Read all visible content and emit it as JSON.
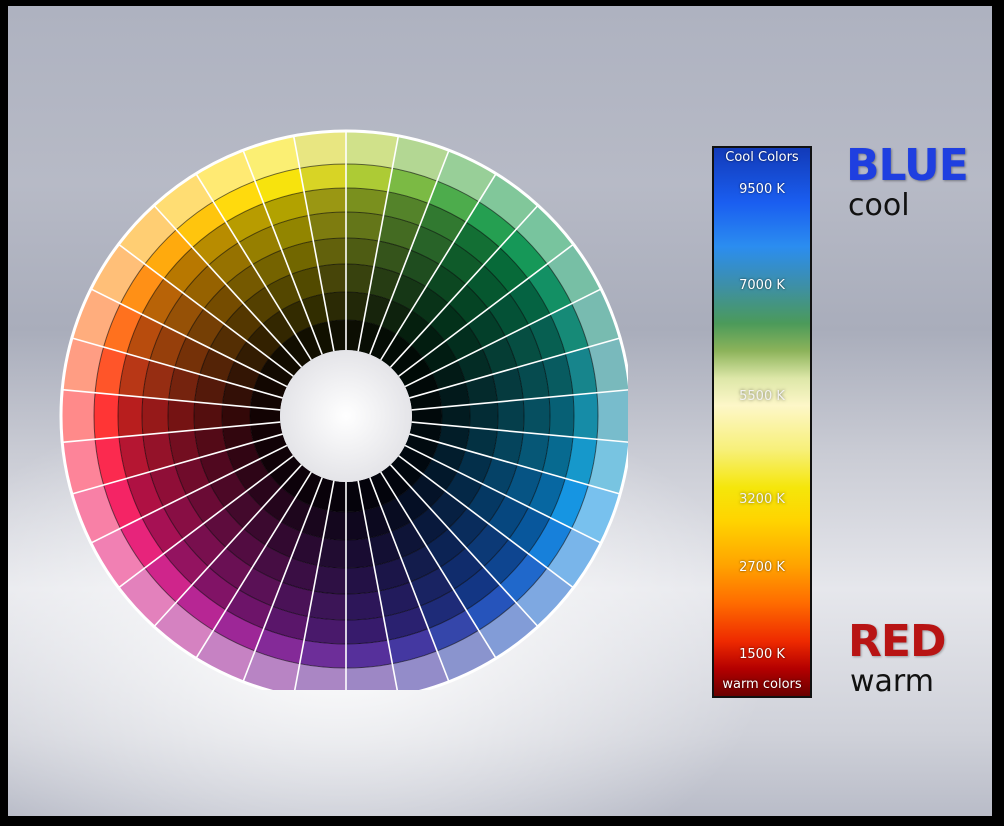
{
  "wheel": {
    "hues": [
      "#ff2a2a",
      "#ff4c1e",
      "#ff6a12",
      "#ff8a0a",
      "#ffa600",
      "#ffc200",
      "#ffd800",
      "#f7e100",
      "#d6d21a",
      "#a9c82a",
      "#74b63a",
      "#44a843",
      "#1a9a48",
      "#0a934f",
      "#078a5c",
      "#0a8470",
      "#0b7f86",
      "#0a86a2",
      "#0a93c8",
      "#0a8fe0",
      "#0b79d8",
      "#1460c8",
      "#1b4bb7",
      "#2a3ca6",
      "#3a2e9c",
      "#4d2596",
      "#652394",
      "#7d1f93",
      "#981c92",
      "#b31b8e",
      "#cc1a85",
      "#e61874",
      "#f3185d",
      "#fb1f46"
    ],
    "colors": {
      "outer_ring_blend": "#ffffff",
      "inner_shade": "#000000",
      "center_fill": "#f7f7f7",
      "divider": "#ffffff",
      "ring_line": "#000000"
    }
  },
  "temperature_scale": {
    "top_label": "Cool Colors",
    "bottom_label": "warm colors",
    "ticks": [
      {
        "label": "9500 K",
        "value": 9500
      },
      {
        "label": "7000 K",
        "value": 7000
      },
      {
        "label": "5500 K",
        "value": 5500
      },
      {
        "label": "3200 K",
        "value": 3200
      },
      {
        "label": "2700 K",
        "value": 2700
      },
      {
        "label": "1500 K",
        "value": 1500
      }
    ]
  },
  "legend": {
    "cool_title": "BLUE",
    "cool_subtitle": "cool",
    "warm_title": "RED",
    "warm_subtitle": "warm",
    "cool_color": "#1f3fe0",
    "warm_color": "#b81414"
  }
}
